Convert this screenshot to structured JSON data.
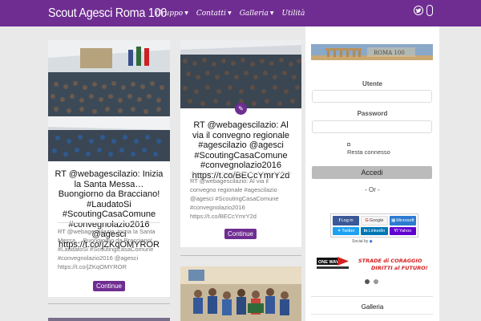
{
  "header": {
    "site_title": "Scout Agesci Roma 100",
    "nav": [
      {
        "label": "Gruppo",
        "has_caret": true
      },
      {
        "label": "Contatti",
        "has_caret": true
      },
      {
        "label": "Galleria",
        "has_caret": true
      },
      {
        "label": "Utilità",
        "has_caret": false
      }
    ],
    "social_icons": [
      "twitter-icon",
      "social-badge-icon"
    ]
  },
  "posts": [
    {
      "title": "RT @webagescilazio: Inizia la Santa Messa… Buongiorno da Bracciano! #LaudatoSi #ScoutingCasaComune #convegnolazio2016 @agesci https://t.co/jZKqOMYROR",
      "excerpt": "RT @webagescilazio: Inizia la Santa Messa… Buongiorno da Bracciano! #LaudatoSi #ScoutingCasaComune #convegnolazio2016 @agesci https://t.co/jZKqOMYROR",
      "button": "Continue"
    },
    {
      "title": "RT @webagescilazio: Al via il convegno regionale #agescilazio @agesci #ScoutingCasaComune #convegnolazio2016 https://t.co/BECcYmrY2d",
      "excerpt": "RT @webagescilazio: Al via il convegno regionale #agescilazio @agesci #ScoutingCasaComune #convegnolazio2016 https://t.co/BECcYmrY2d",
      "button": "Continue"
    }
  ],
  "sidebar": {
    "username_label": "Utente",
    "password_label": "Password",
    "remember_label": "Resta connesso",
    "login_button": "Accedi",
    "or_text": "- Or -",
    "social_buttons": [
      {
        "label": "Log in",
        "color": "#3b5998"
      },
      {
        "label": "Google",
        "color": "#dd4b39"
      },
      {
        "label": "Microsoft",
        "color": "#00a4ef"
      },
      {
        "label": "Twitter",
        "color": "#1da1f2"
      },
      {
        "label": "LinkedIn",
        "color": "#0077b5"
      },
      {
        "label": "Yahoo",
        "color": "#6001d2"
      }
    ],
    "social_by": "Social by",
    "strade_left": "ONE WAY",
    "strade_right_1": "STRADE di CORAGGIO",
    "strade_right_2": "DIRITTI al FUTURO!",
    "widget_title": "Galleria"
  },
  "colors": {
    "brand": "#6f2d91",
    "background": "#e9e9e9"
  }
}
